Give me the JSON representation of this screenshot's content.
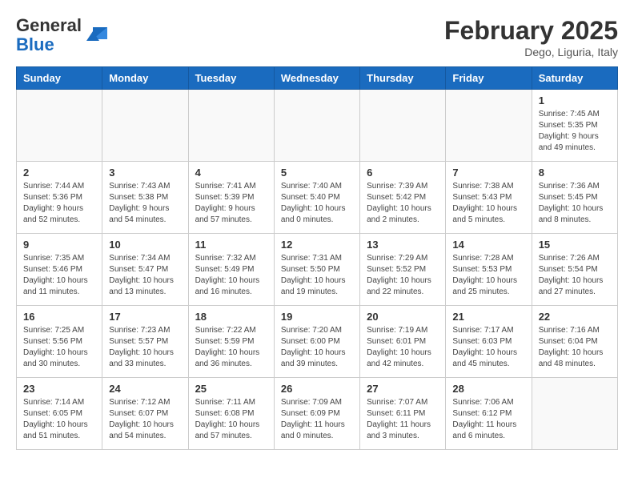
{
  "header": {
    "logo_general": "General",
    "logo_blue": "Blue",
    "month_year": "February 2025",
    "location": "Dego, Liguria, Italy"
  },
  "days_of_week": [
    "Sunday",
    "Monday",
    "Tuesday",
    "Wednesday",
    "Thursday",
    "Friday",
    "Saturday"
  ],
  "weeks": [
    {
      "days": [
        {
          "num": "",
          "info": ""
        },
        {
          "num": "",
          "info": ""
        },
        {
          "num": "",
          "info": ""
        },
        {
          "num": "",
          "info": ""
        },
        {
          "num": "",
          "info": ""
        },
        {
          "num": "",
          "info": ""
        },
        {
          "num": "1",
          "info": "Sunrise: 7:45 AM\nSunset: 5:35 PM\nDaylight: 9 hours and 49 minutes."
        }
      ]
    },
    {
      "days": [
        {
          "num": "2",
          "info": "Sunrise: 7:44 AM\nSunset: 5:36 PM\nDaylight: 9 hours and 52 minutes."
        },
        {
          "num": "3",
          "info": "Sunrise: 7:43 AM\nSunset: 5:38 PM\nDaylight: 9 hours and 54 minutes."
        },
        {
          "num": "4",
          "info": "Sunrise: 7:41 AM\nSunset: 5:39 PM\nDaylight: 9 hours and 57 minutes."
        },
        {
          "num": "5",
          "info": "Sunrise: 7:40 AM\nSunset: 5:40 PM\nDaylight: 10 hours and 0 minutes."
        },
        {
          "num": "6",
          "info": "Sunrise: 7:39 AM\nSunset: 5:42 PM\nDaylight: 10 hours and 2 minutes."
        },
        {
          "num": "7",
          "info": "Sunrise: 7:38 AM\nSunset: 5:43 PM\nDaylight: 10 hours and 5 minutes."
        },
        {
          "num": "8",
          "info": "Sunrise: 7:36 AM\nSunset: 5:45 PM\nDaylight: 10 hours and 8 minutes."
        }
      ]
    },
    {
      "days": [
        {
          "num": "9",
          "info": "Sunrise: 7:35 AM\nSunset: 5:46 PM\nDaylight: 10 hours and 11 minutes."
        },
        {
          "num": "10",
          "info": "Sunrise: 7:34 AM\nSunset: 5:47 PM\nDaylight: 10 hours and 13 minutes."
        },
        {
          "num": "11",
          "info": "Sunrise: 7:32 AM\nSunset: 5:49 PM\nDaylight: 10 hours and 16 minutes."
        },
        {
          "num": "12",
          "info": "Sunrise: 7:31 AM\nSunset: 5:50 PM\nDaylight: 10 hours and 19 minutes."
        },
        {
          "num": "13",
          "info": "Sunrise: 7:29 AM\nSunset: 5:52 PM\nDaylight: 10 hours and 22 minutes."
        },
        {
          "num": "14",
          "info": "Sunrise: 7:28 AM\nSunset: 5:53 PM\nDaylight: 10 hours and 25 minutes."
        },
        {
          "num": "15",
          "info": "Sunrise: 7:26 AM\nSunset: 5:54 PM\nDaylight: 10 hours and 27 minutes."
        }
      ]
    },
    {
      "days": [
        {
          "num": "16",
          "info": "Sunrise: 7:25 AM\nSunset: 5:56 PM\nDaylight: 10 hours and 30 minutes."
        },
        {
          "num": "17",
          "info": "Sunrise: 7:23 AM\nSunset: 5:57 PM\nDaylight: 10 hours and 33 minutes."
        },
        {
          "num": "18",
          "info": "Sunrise: 7:22 AM\nSunset: 5:59 PM\nDaylight: 10 hours and 36 minutes."
        },
        {
          "num": "19",
          "info": "Sunrise: 7:20 AM\nSunset: 6:00 PM\nDaylight: 10 hours and 39 minutes."
        },
        {
          "num": "20",
          "info": "Sunrise: 7:19 AM\nSunset: 6:01 PM\nDaylight: 10 hours and 42 minutes."
        },
        {
          "num": "21",
          "info": "Sunrise: 7:17 AM\nSunset: 6:03 PM\nDaylight: 10 hours and 45 minutes."
        },
        {
          "num": "22",
          "info": "Sunrise: 7:16 AM\nSunset: 6:04 PM\nDaylight: 10 hours and 48 minutes."
        }
      ]
    },
    {
      "days": [
        {
          "num": "23",
          "info": "Sunrise: 7:14 AM\nSunset: 6:05 PM\nDaylight: 10 hours and 51 minutes."
        },
        {
          "num": "24",
          "info": "Sunrise: 7:12 AM\nSunset: 6:07 PM\nDaylight: 10 hours and 54 minutes."
        },
        {
          "num": "25",
          "info": "Sunrise: 7:11 AM\nSunset: 6:08 PM\nDaylight: 10 hours and 57 minutes."
        },
        {
          "num": "26",
          "info": "Sunrise: 7:09 AM\nSunset: 6:09 PM\nDaylight: 11 hours and 0 minutes."
        },
        {
          "num": "27",
          "info": "Sunrise: 7:07 AM\nSunset: 6:11 PM\nDaylight: 11 hours and 3 minutes."
        },
        {
          "num": "28",
          "info": "Sunrise: 7:06 AM\nSunset: 6:12 PM\nDaylight: 11 hours and 6 minutes."
        },
        {
          "num": "",
          "info": ""
        }
      ]
    }
  ]
}
